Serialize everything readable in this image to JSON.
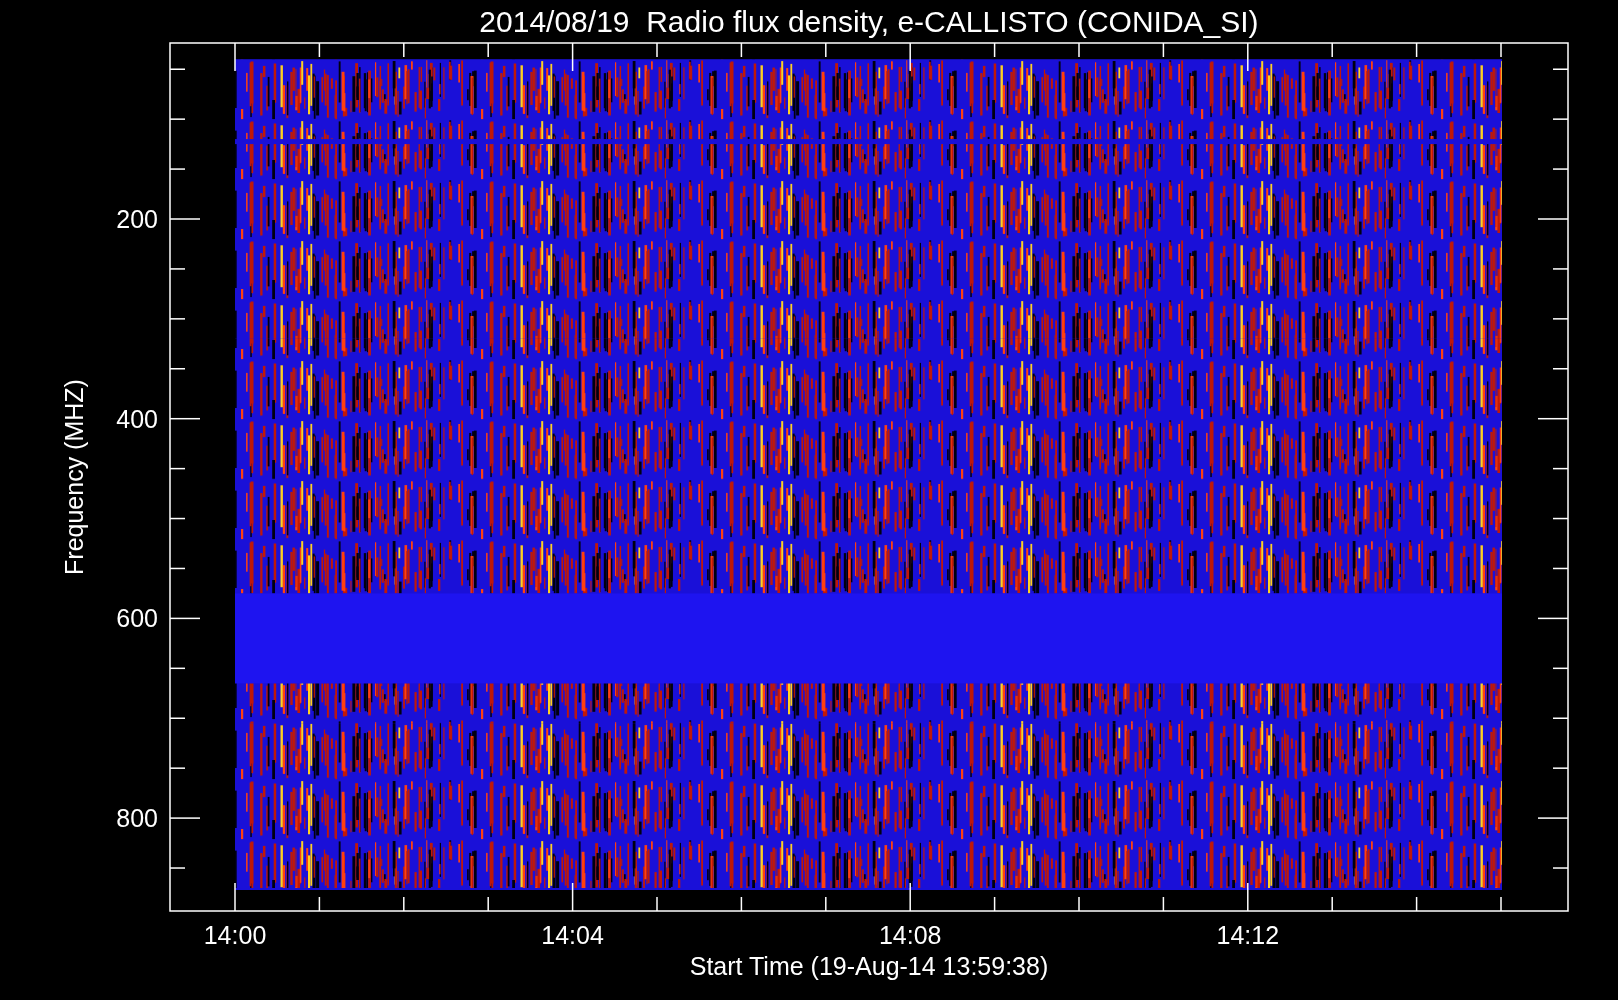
{
  "title": "2014/08/19  Radio flux density, e-CALLISTO (CONIDA_SI)",
  "plot": {
    "ylabel": "Frequency (MHZ)",
    "xlabel": "Start Time (19-Aug-14 13:59:38)",
    "yticks": [
      "200",
      "400",
      "600",
      "800"
    ],
    "xticks": [
      "14:00",
      "14:04",
      "14:08",
      "14:12"
    ]
  }
}
